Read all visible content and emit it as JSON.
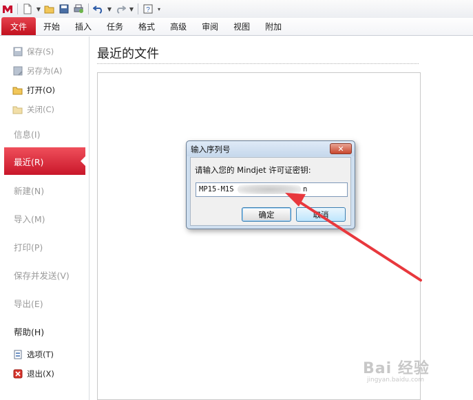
{
  "toolbar": {
    "icons": [
      "mindjet-logo-icon",
      "new-doc-icon",
      "open-folder-icon",
      "save-icon",
      "print-icon",
      "undo-icon",
      "redo-icon",
      "help-icon"
    ]
  },
  "ribbon": {
    "tabs": [
      "文件",
      "开始",
      "插入",
      "任务",
      "格式",
      "高级",
      "审阅",
      "视图",
      "附加"
    ]
  },
  "backstage": {
    "commands": {
      "save": "保存(S)",
      "save_as": "另存为(A)",
      "open": "打开(O)",
      "close": "关闭(C)"
    },
    "sections": {
      "info": "信息(I)",
      "recent": "最近(R)",
      "new": "新建(N)",
      "import": "导入(M)",
      "print": "打印(P)",
      "save_send": "保存并发送(V)",
      "export": "导出(E)",
      "help": "帮助(H)"
    },
    "bottom": {
      "options": "选项(T)",
      "exit": "退出(X)"
    }
  },
  "main": {
    "title": "最近的文件"
  },
  "dialog": {
    "title": "输入序列号",
    "close_glyph": "✕",
    "prompt": "请输入您的 Mindjet 许可证密钥:",
    "key_value_prefix": "MP15-M1S",
    "key_value_suffix": "n",
    "ok_label": "确定",
    "cancel_label": "取消"
  },
  "watermark": {
    "brand": "Bai 经验",
    "url": "jingyan.baidu.com"
  },
  "colors": {
    "accent_red": "#d42330",
    "arrow_red": "#e8383d",
    "dialog_frame": "#cfdff0"
  }
}
